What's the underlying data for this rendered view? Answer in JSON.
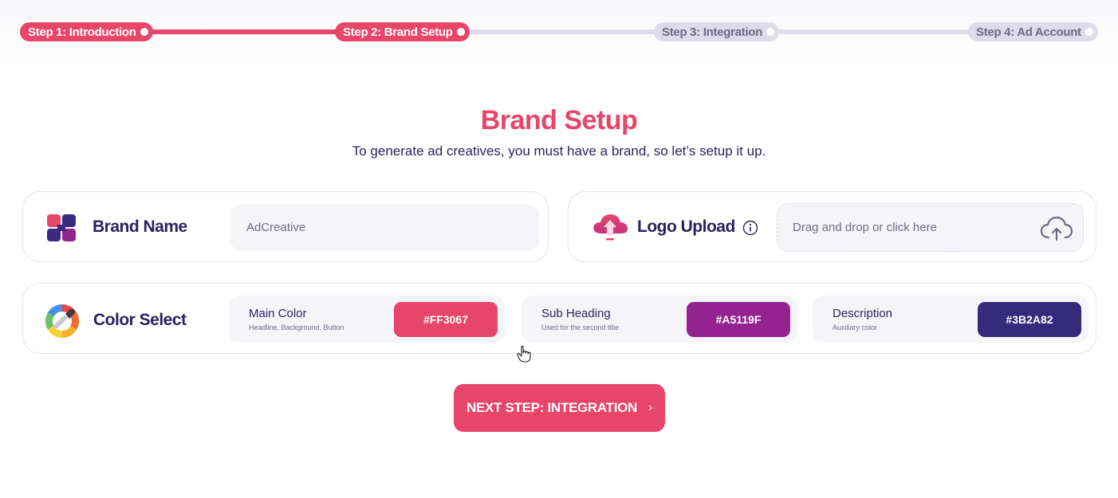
{
  "stepper": {
    "steps": [
      {
        "label": "Step 1: Introduction",
        "state": "completed"
      },
      {
        "label": "Step 2: Brand Setup",
        "state": "active"
      },
      {
        "label": "Step 3: Integration",
        "state": "upcoming"
      },
      {
        "label": "Step 4: Ad Account",
        "state": "upcoming"
      }
    ]
  },
  "header": {
    "title": "Brand Setup",
    "subtitle": "To generate ad creatives, you must have a brand, so let’s setup it up."
  },
  "brand_name": {
    "label": "Brand Name",
    "icon": "brand-blocks-icon",
    "input_value": "AdCreative"
  },
  "logo_upload": {
    "label": "Logo Upload",
    "icon": "cloud-upload-icon",
    "info_icon": "info-icon",
    "dropzone_text": "Drag and drop or click here"
  },
  "color_select": {
    "label": "Color Select",
    "icon": "color-picker-icon",
    "swatches": [
      {
        "title": "Main Color",
        "description": "Headline, Background, Button",
        "value": "#FF3067",
        "color": "#e8456a"
      },
      {
        "title": "Sub Heading",
        "description": "Used for the second title",
        "value": "#A5119F",
        "color": "#95238f"
      },
      {
        "title": "Description",
        "description": "Auxiliary color",
        "value": "#3B2A82",
        "color": "#352a7c"
      }
    ]
  },
  "next_button": {
    "label": "NEXT STEP: INTEGRATION",
    "icon": "chevron-right-icon",
    "chevron": "›"
  },
  "colors": {
    "accent": "#e8456a",
    "text_dark": "#2a2260",
    "inactive": "#dedbea"
  }
}
